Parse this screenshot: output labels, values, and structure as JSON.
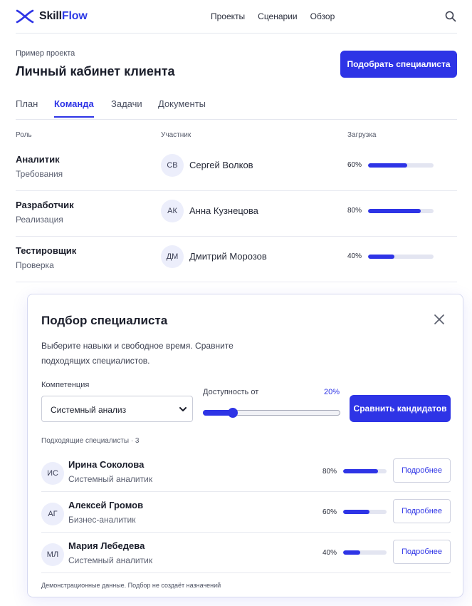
{
  "header": {
    "logo_primary": "Skill",
    "logo_accent": "Flow",
    "nav": [
      "Проекты",
      "Сценарии",
      "Обзор"
    ],
    "icons": {
      "logo": "skillflow-logo-icon",
      "search": "search-icon"
    }
  },
  "page": {
    "eyebrow": "Пример проекта",
    "title": "Личный кабинет клиента",
    "primary_action": "Подобрать специалиста"
  },
  "tabs": [
    {
      "label": "План",
      "active": false
    },
    {
      "label": "Команда",
      "active": true
    },
    {
      "label": "Задачи",
      "active": false
    },
    {
      "label": "Документы",
      "active": false
    }
  ],
  "team": {
    "columns": {
      "role": "Роль",
      "member": "Участник",
      "load": "Загрузка"
    },
    "rows": [
      {
        "role": "Аналитик",
        "area": "Требования",
        "initials": "СВ",
        "member": "Сергей Волков",
        "load_label": "60%",
        "load": 60
      },
      {
        "role": "Разработчик",
        "area": "Реализация",
        "initials": "АК",
        "member": "Анна Кузнецова",
        "load_label": "80%",
        "load": 80
      },
      {
        "role": "Тестировщик",
        "area": "Проверка",
        "initials": "ДМ",
        "member": "Дмитрий Морозов",
        "load_label": "40%",
        "load": 40
      }
    ]
  },
  "modal": {
    "title": "Подбор специалиста",
    "description": "Выберите навыки и свободное время. Сравните подходящих специалистов.",
    "competence_label": "Компетенция",
    "competence_value": "Системный анализ",
    "availability_label": "Доступность от",
    "availability_value_label": "20%",
    "availability_value": 20,
    "compare_button": "Сравнить кандидатов",
    "list_caption": "Подходящие специалисты · 3",
    "candidates": [
      {
        "initials": "ИС",
        "name": "Ирина Соколова",
        "role": "Системный аналитик",
        "load_label": "80%",
        "load": 80,
        "action": "Подробнее"
      },
      {
        "initials": "АГ",
        "name": "Алексей Громов",
        "role": "Бизнес-аналитик",
        "load_label": "60%",
        "load": 60,
        "action": "Подробнее"
      },
      {
        "initials": "МЛ",
        "name": "Мария Лебедева",
        "role": "Системный аналитик",
        "load_label": "40%",
        "load": 40,
        "action": "Подробнее"
      }
    ],
    "footnote": "Демонстрационные данные. Подбор не создаёт назначений",
    "icons": {
      "close": "close-icon",
      "select": "chevron-down-icon"
    }
  },
  "colors": {
    "accent": "#2e34e6",
    "track": "#e3e5f1",
    "avatar_bg": "#eceefb",
    "border": "#e4e6ee"
  }
}
